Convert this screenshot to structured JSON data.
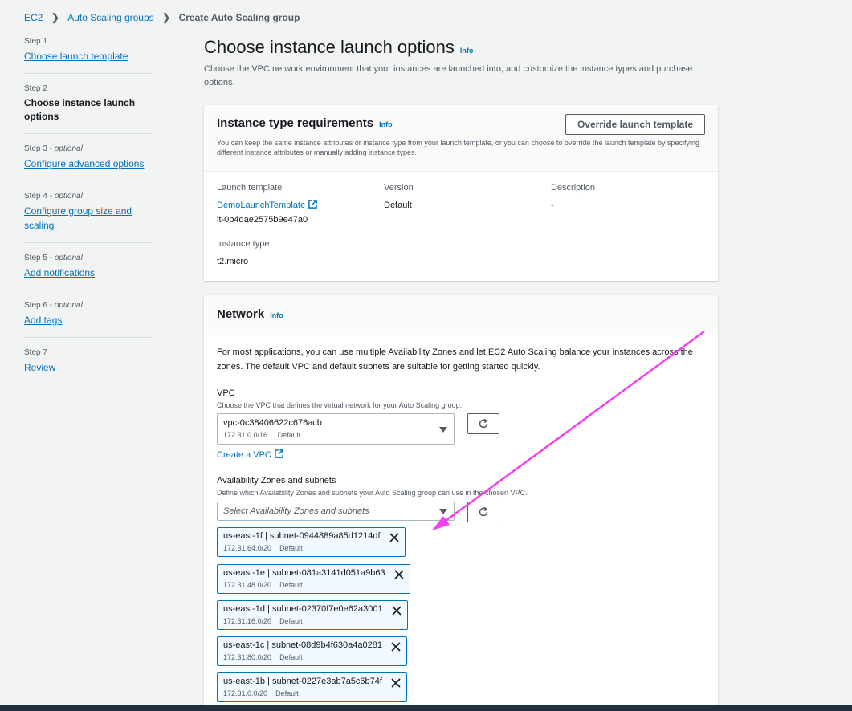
{
  "breadcrumb": {
    "ec2": "EC2",
    "asg": "Auto Scaling groups",
    "current": "Create Auto Scaling group"
  },
  "steps": [
    {
      "no": "Step 1",
      "opt": "",
      "title": "Choose launch template"
    },
    {
      "no": "Step 2",
      "opt": "",
      "title": "Choose instance launch options"
    },
    {
      "no": "Step 3 - ",
      "opt": "optional",
      "title": "Configure advanced options"
    },
    {
      "no": "Step 4 - ",
      "opt": "optional",
      "title": "Configure group size and scaling"
    },
    {
      "no": "Step 5 - ",
      "opt": "optional",
      "title": "Add notifications"
    },
    {
      "no": "Step 6 - ",
      "opt": "optional",
      "title": "Add tags"
    },
    {
      "no": "Step 7",
      "opt": "",
      "title": "Review"
    }
  ],
  "page": {
    "title": "Choose instance launch options",
    "info": "Info",
    "description": "Choose the VPC network environment that your instances are launched into, and customize the instance types and purchase options."
  },
  "instance_panel": {
    "title": "Instance type requirements",
    "info": "Info",
    "override_button": "Override launch template",
    "description": "You can keep the same instance attributes or instance type from your launch template, or you can choose to override the launch template by specifying different instance attributes or manually adding instance types.",
    "launch_template_label": "Launch template",
    "launch_template_name": "DemoLaunchTemplate",
    "launch_template_id": "lt-0b4dae2575b9e47a0",
    "version_label": "Version",
    "version_value": "Default",
    "description_label": "Description",
    "description_value": "-",
    "instance_type_label": "Instance type",
    "instance_type_value": "t2.micro"
  },
  "network_panel": {
    "title": "Network",
    "info": "Info",
    "intro": "For most applications, you can use multiple Availability Zones and let EC2 Auto Scaling balance your instances across the zones. The default VPC and default subnets are suitable for getting started quickly.",
    "vpc_label": "VPC",
    "vpc_help": "Choose the VPC that defines the virtual network for your Auto Scaling group.",
    "vpc_value": "vpc-0c38406622c676acb",
    "vpc_cidr": "172.31.0.0/16",
    "vpc_default": "Default",
    "create_vpc": "Create a VPC",
    "az_label": "Availability Zones and subnets",
    "az_help": "Define which Availability Zones and subnets your Auto Scaling group can use in the chosen VPC.",
    "az_placeholder": "Select Availability Zones and subnets",
    "subnets": [
      {
        "name": "us-east-1f | subnet-0944889a85d1214df",
        "cidr": "172.31.64.0/20",
        "tag": "Default"
      },
      {
        "name": "us-east-1e | subnet-081a3141d051a9b63",
        "cidr": "172.31.48.0/20",
        "tag": "Default"
      },
      {
        "name": "us-east-1d | subnet-02370f7e0e62a3001",
        "cidr": "172.31.16.0/20",
        "tag": "Default"
      },
      {
        "name": "us-east-1c | subnet-08d9b4f630a4a0281",
        "cidr": "172.31.80.0/20",
        "tag": "Default"
      },
      {
        "name": "us-east-1b | subnet-0227e3ab7a5c6b74f",
        "cidr": "172.31.0.0/20",
        "tag": "Default"
      }
    ]
  },
  "colors": {
    "link": "#0073bb",
    "annotation_arrow": "#f040f0",
    "token_bg": "#f1faff"
  }
}
